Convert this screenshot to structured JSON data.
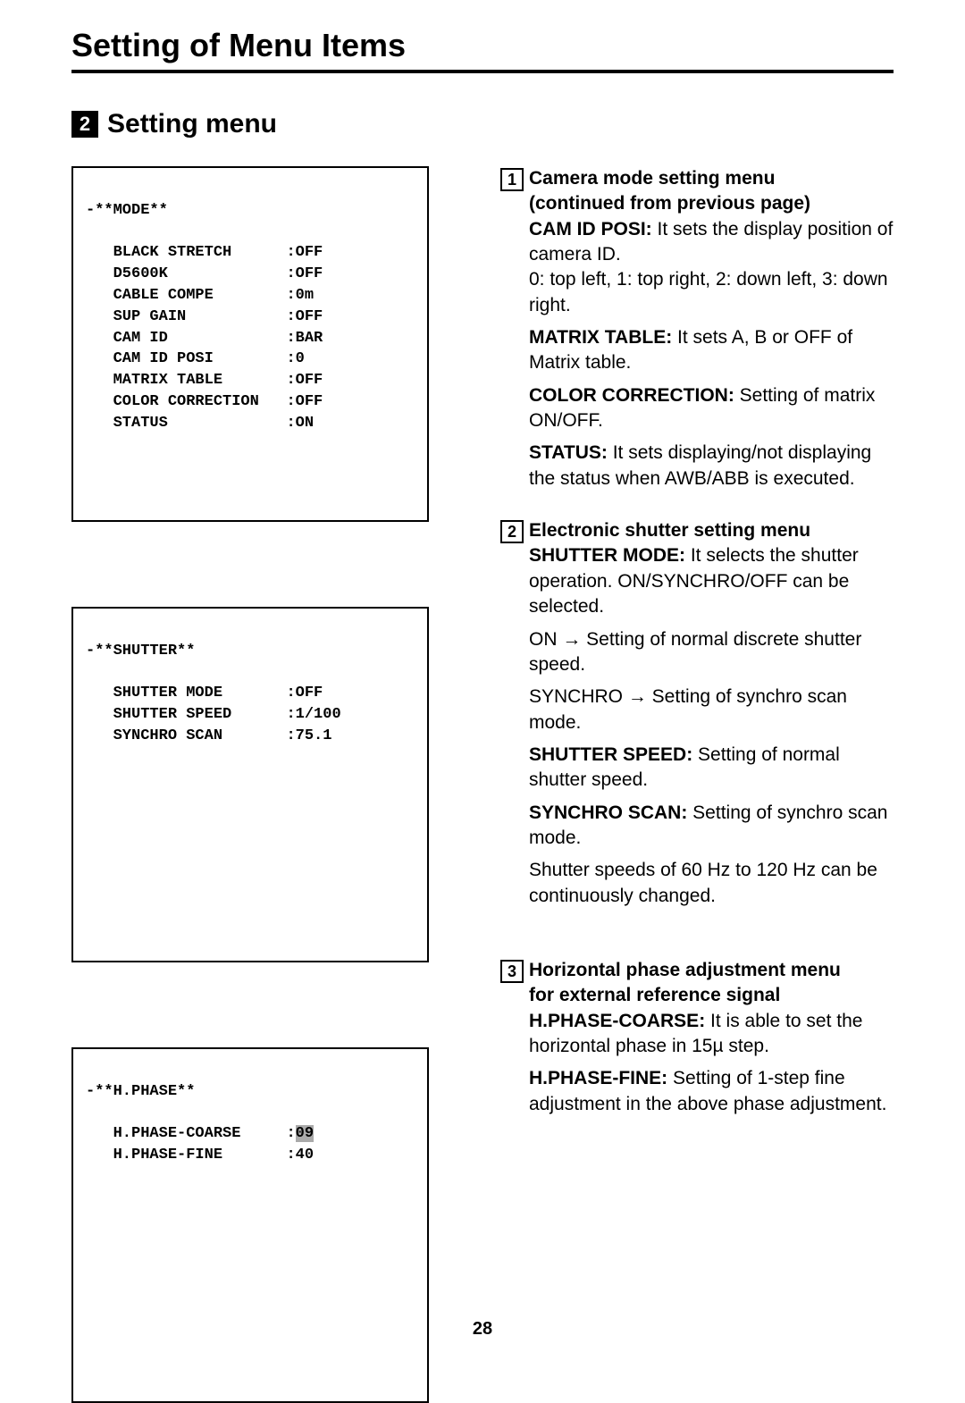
{
  "page_title": "Setting of Menu Items",
  "section_num": "2",
  "section_title": "Setting menu",
  "page_number": "28",
  "mode_box": {
    "header": "-**MODE**",
    "rows": [
      {
        "name": "BLACK STRETCH",
        "value": ":OFF"
      },
      {
        "name": "D5600K",
        "value": ":OFF"
      },
      {
        "name": "CABLE COMPE",
        "value": ":0m"
      },
      {
        "name": "SUP GAIN",
        "value": ":OFF"
      },
      {
        "name": "CAM ID",
        "value": ":BAR"
      },
      {
        "name": "CAM ID POSI",
        "value": ":0"
      },
      {
        "name": "MATRIX TABLE",
        "value": ":OFF"
      },
      {
        "name": "COLOR CORRECTION",
        "value": ":OFF"
      },
      {
        "name": "STATUS",
        "value": ":ON"
      }
    ]
  },
  "shutter_box": {
    "header": "-**SHUTTER**",
    "rows": [
      {
        "name": "SHUTTER MODE",
        "value": ":OFF"
      },
      {
        "name": "SHUTTER SPEED",
        "value": ":1/100"
      },
      {
        "name": "SYNCHRO SCAN",
        "value": ":75.1"
      }
    ]
  },
  "hphase_box": {
    "header": "-**H.PHASE**",
    "rows": [
      {
        "name": "H.PHASE-COARSE",
        "value_prefix": ":",
        "value_hl": "09"
      },
      {
        "name": "H.PHASE-FINE",
        "value": ":40"
      }
    ]
  },
  "desc1": {
    "num": "1",
    "title_line1": "Camera mode setting menu",
    "title_line2": "(continued from previous page)",
    "cam_id_posi_label": "CAM ID POSI:",
    "cam_id_posi_text": " It sets the display position of camera ID.",
    "cam_id_posi_text2": "0: top left, 1: top right, 2: down left, 3: down right.",
    "matrix_label": "MATRIX TABLE:",
    "matrix_text": " It sets A, B or OFF of Matrix table.",
    "color_label": "COLOR CORRECTION:",
    "color_text": " Setting of matrix ON/OFF.",
    "status_label": "STATUS:",
    "status_text": " It sets displaying/not displaying the status when AWB/ABB is executed."
  },
  "desc2": {
    "num": "2",
    "title": "Electronic shutter setting menu",
    "sm_label": "SHUTTER MODE:",
    "sm_text": " It selects the shutter operation. ON/SYNCHRO/OFF can be selected.",
    "on_text": "ON → Setting of normal discrete shutter speed.",
    "sync_text": "SYNCHRO → Setting of synchro scan mode.",
    "ss_label": "SHUTTER SPEED:",
    "ss_text": " Setting of normal shutter speed.",
    "sc_label": "SYNCHRO SCAN:",
    "sc_text": " Setting of synchro scan mode.",
    "range_text": "Shutter speeds of 60 Hz to 120 Hz can be continuously changed."
  },
  "desc3": {
    "num": "3",
    "title_line1": "Horizontal phase adjustment menu",
    "title_line2": "for external reference signal",
    "hc_label": "H.PHASE-COARSE:",
    "hc_text": " It is able to set the horizontal phase in 15µ step.",
    "hf_label": "H.PHASE-FINE:",
    "hf_text": " Setting of 1-step fine adjustment in the above phase adjustment."
  }
}
